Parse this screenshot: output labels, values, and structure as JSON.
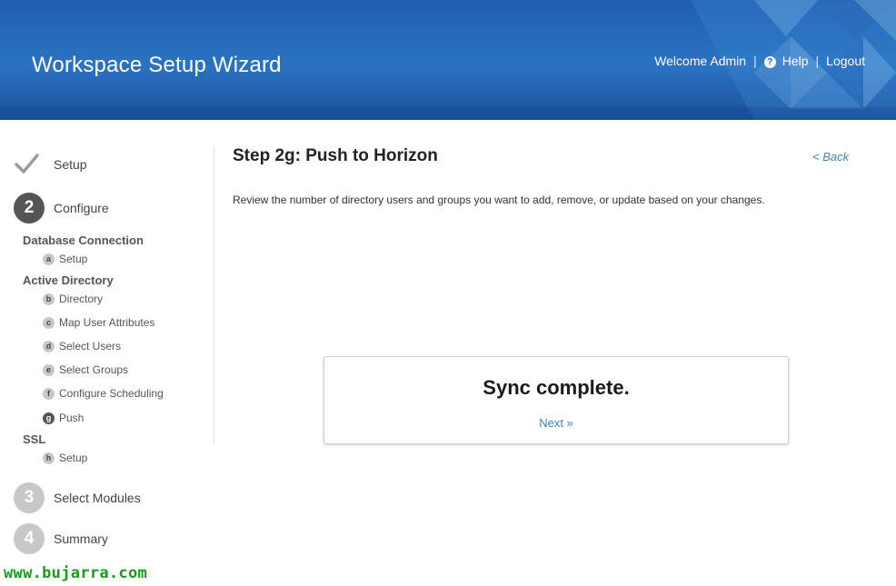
{
  "header": {
    "title": "Workspace Setup Wizard",
    "welcome": "Welcome Admin",
    "help": "Help",
    "logout": "Logout",
    "separator": "|"
  },
  "sidebar": {
    "steps": [
      {
        "number": "",
        "label": "Setup",
        "state": "complete"
      },
      {
        "number": "2",
        "label": "Configure",
        "state": "active"
      },
      {
        "number": "3",
        "label": "Select Modules",
        "state": "inactive"
      },
      {
        "number": "4",
        "label": "Summary",
        "state": "inactive"
      }
    ],
    "groups": [
      {
        "title": "Database Connection",
        "items": [
          {
            "badge": "a",
            "label": "Setup"
          }
        ]
      },
      {
        "title": "Active Directory",
        "items": [
          {
            "badge": "b",
            "label": "Directory"
          },
          {
            "badge": "c",
            "label": "Map User Attributes"
          },
          {
            "badge": "d",
            "label": "Select Users"
          },
          {
            "badge": "e",
            "label": "Select Groups"
          },
          {
            "badge": "f",
            "label": "Configure Scheduling"
          },
          {
            "badge": "g",
            "label": "Push",
            "active": true
          }
        ]
      },
      {
        "title": "SSL",
        "items": [
          {
            "badge": "h",
            "label": "Setup"
          }
        ]
      }
    ]
  },
  "main": {
    "step_title": "Step 2g: Push to Horizon",
    "back_link": "< Back",
    "description": "Review the number of directory users and groups you want to add, remove, or update based on your changes.",
    "sync_title": "Sync complete.",
    "next_link": "Next »"
  },
  "watermark": "www.bujarra.com",
  "colors": {
    "header_blue": "#2b73c2",
    "link_blue": "#3b82bf",
    "active_step": "#555555",
    "inactive_step": "#c8c8c8",
    "watermark_green": "#1c9a1c"
  }
}
